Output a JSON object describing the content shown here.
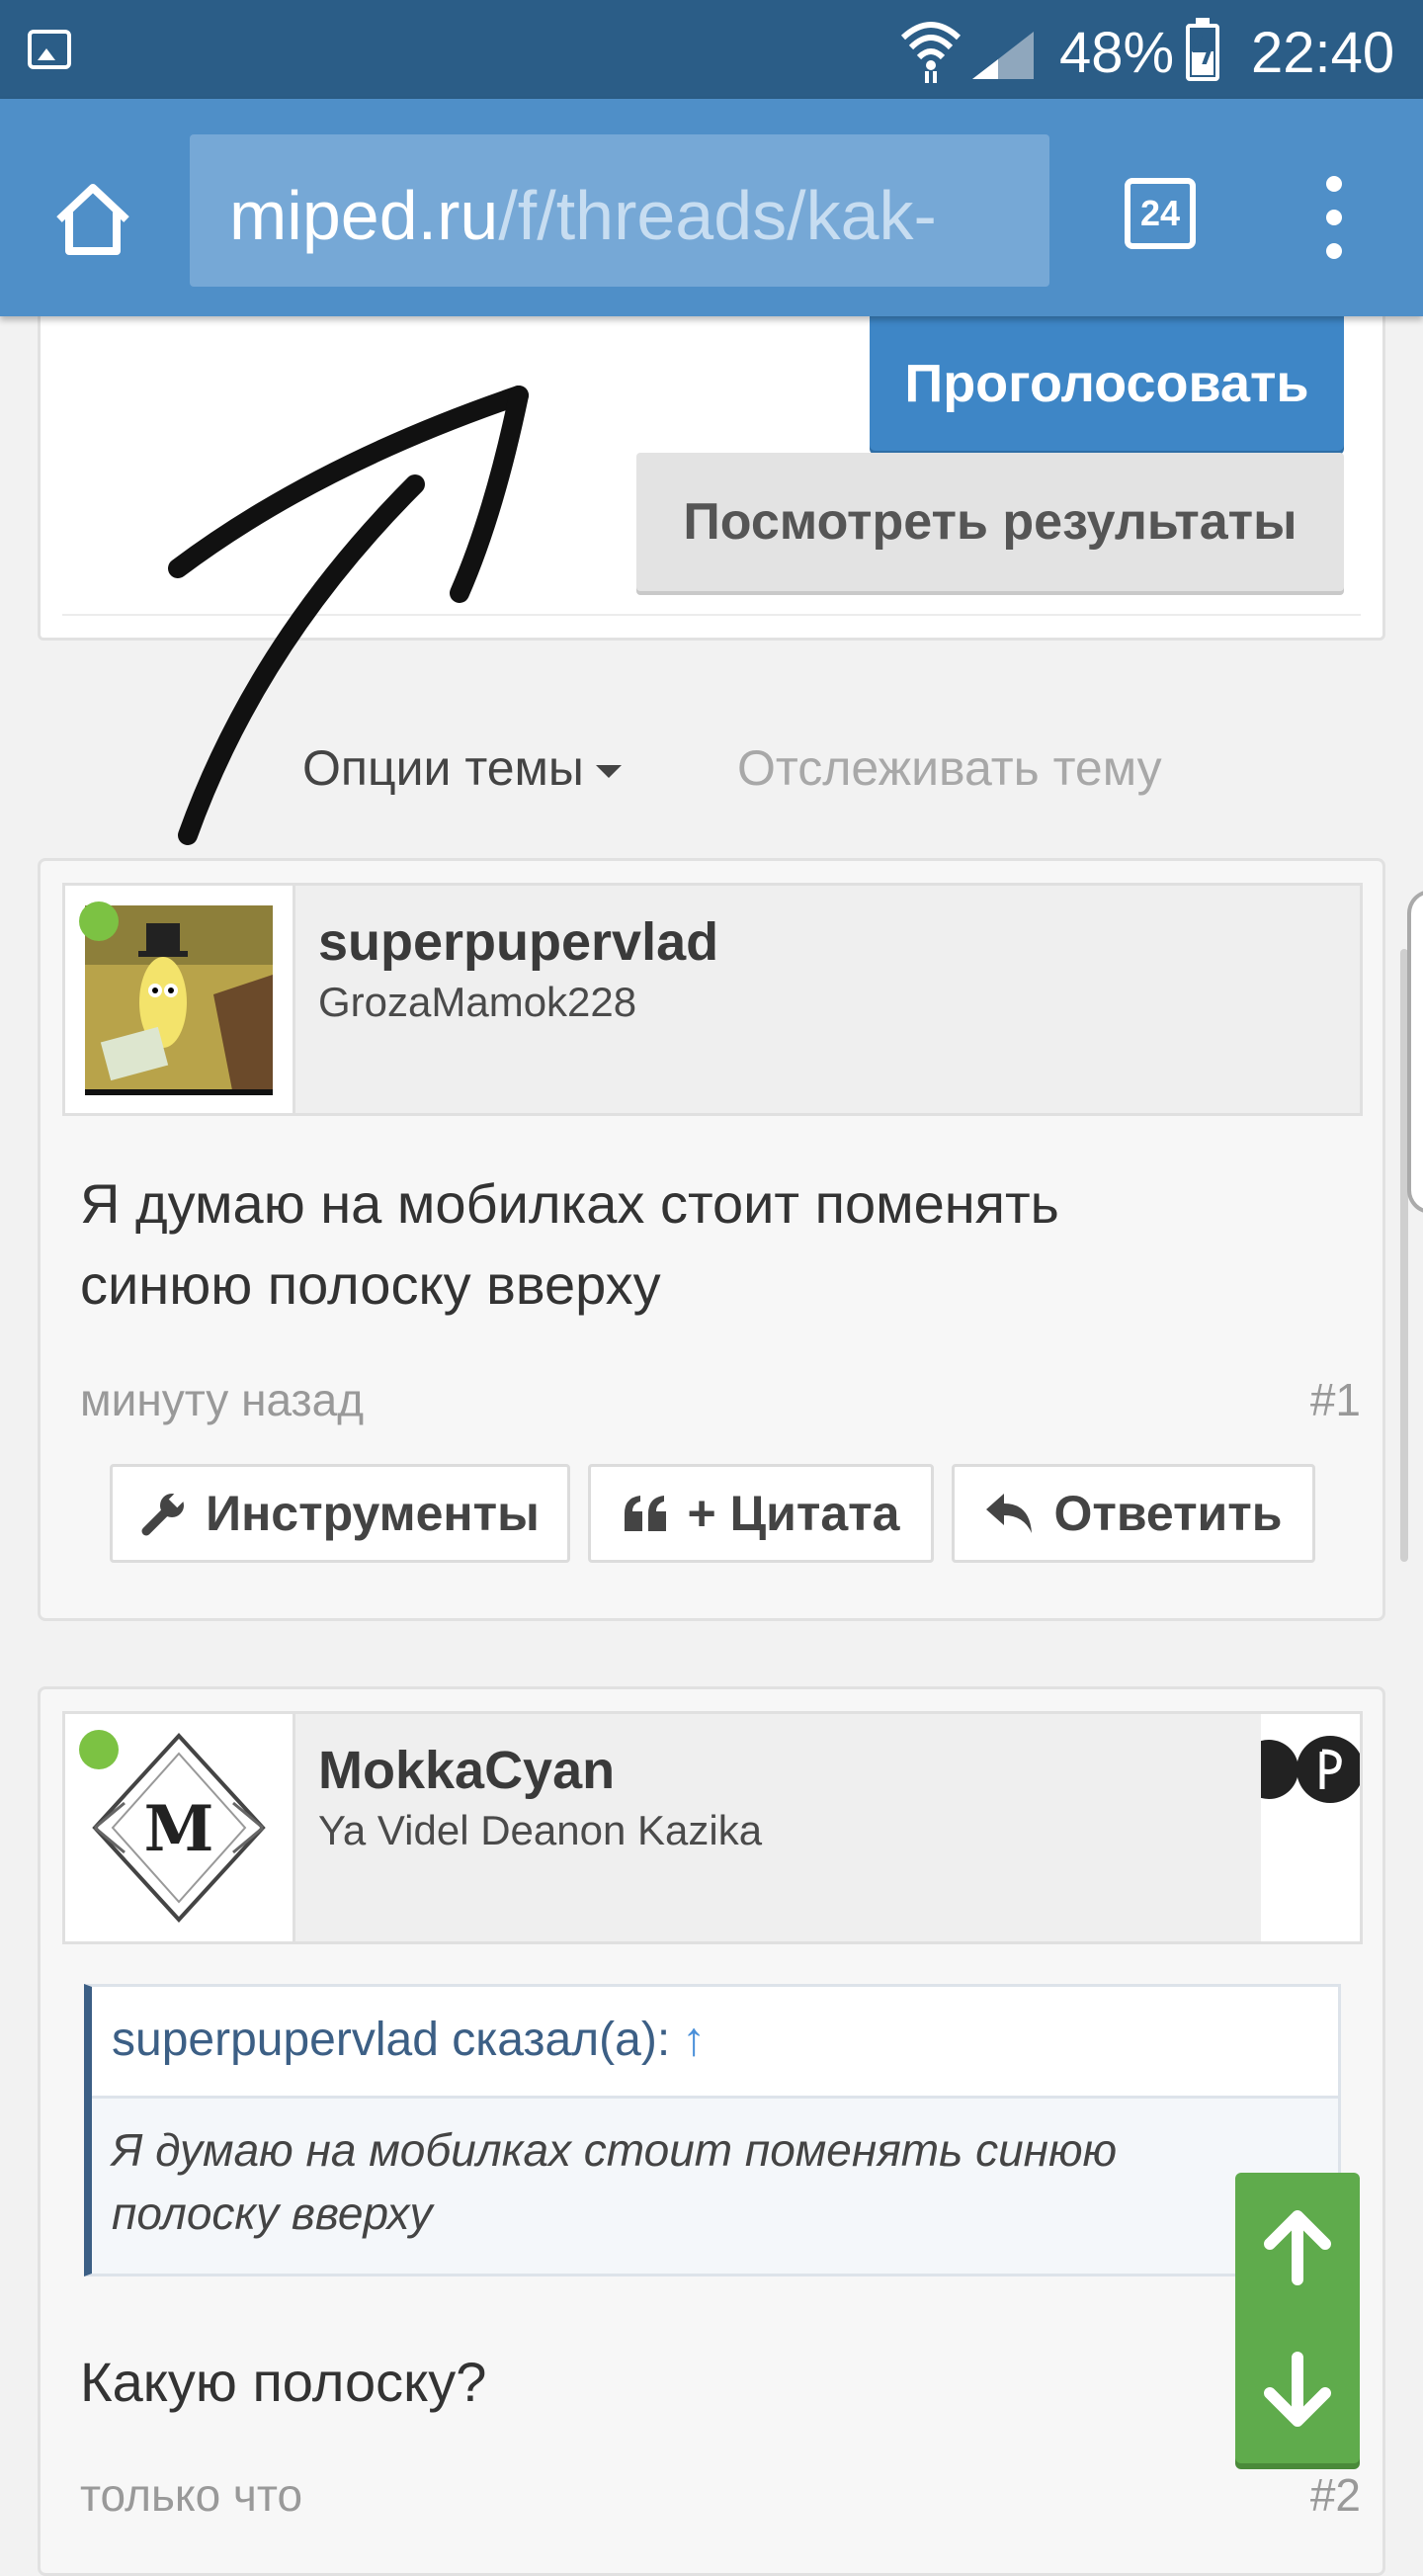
{
  "status_bar": {
    "battery_percent": "48%",
    "time": "22:40",
    "battery_level": 0.48
  },
  "browser": {
    "url_domain": "miped.ru",
    "url_path": "/f/threads/kak-",
    "tab_count": "24"
  },
  "poll": {
    "vote_label": "Проголосовать",
    "results_label": "Посмотреть результаты"
  },
  "thread_controls": {
    "options_label": "Опции темы",
    "watch_label": "Отслеживать тему"
  },
  "posts": [
    {
      "username": "superpupervlad",
      "user_title": "GrozaMamok228",
      "message_line1": "Я думаю на мобилках стоит поменять",
      "message_line2": "синюю полоску вверху",
      "date": "минуту назад",
      "number": "#1",
      "actions": {
        "tools": "Инструменты",
        "quote": "+ Цитата",
        "reply": "Ответить"
      }
    },
    {
      "username": "MokkaCyan",
      "user_title": "Ya Videl Deanon Kazika",
      "quote_author": "superpupervlad сказал(а):",
      "quote_arrow": "↑",
      "quote_line1": "Я думаю на мобилках стоит поменять синюю",
      "quote_line2": "полоску вверху",
      "message": "Какую полоску?",
      "date": "только что",
      "number": "#2",
      "avatar_letter": "M"
    }
  ],
  "icons": [
    "gallery-icon",
    "wifi-icon",
    "signal-icon",
    "battery-icon",
    "home-icon",
    "tabs-icon",
    "overflow-menu-icon",
    "caret-down-icon",
    "wrench-icon",
    "quote-icon",
    "reply-icon",
    "arrow-up-icon",
    "arrow-down-icon",
    "playstation-icon"
  ],
  "colors": {
    "status_bar": "#2b5d87",
    "toolbar": "#4f8fc8",
    "vote_button": "#3e86c6",
    "online": "#7cc243",
    "scroll_nav": "#5fab4c"
  }
}
